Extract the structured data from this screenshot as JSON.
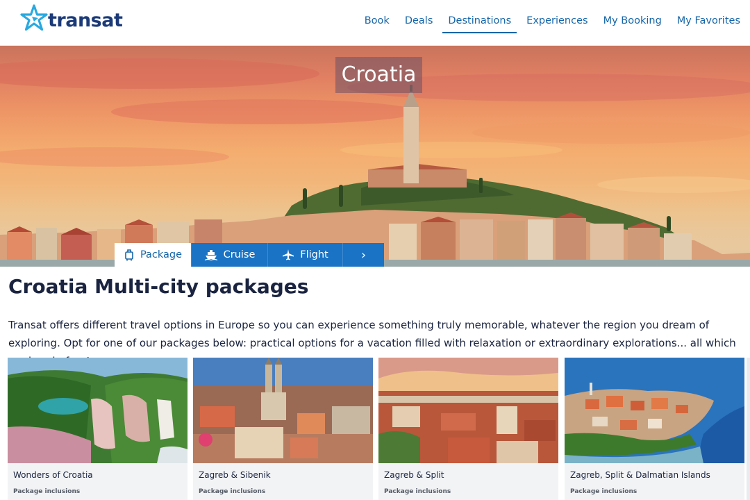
{
  "brand": {
    "name": "transat",
    "logo_icon": "star-icon",
    "colors": {
      "primary": "#1565a8",
      "navy": "#1b3a78",
      "accent_star": "#29a9e0"
    }
  },
  "nav": {
    "items": [
      {
        "label": "Book"
      },
      {
        "label": "Deals"
      },
      {
        "label": "Destinations",
        "active": true
      },
      {
        "label": "Experiences"
      },
      {
        "label": "My Booking"
      },
      {
        "label": "My Favorites"
      }
    ]
  },
  "hero": {
    "title": "Croatia"
  },
  "tabs": {
    "package": {
      "label": "Package",
      "icon": "luggage-icon"
    },
    "cruise": {
      "label": "Cruise",
      "icon": "ship-icon"
    },
    "flight": {
      "label": "Flight",
      "icon": "plane-icon"
    },
    "more": {
      "label": "›",
      "icon": "chevron-right-icon"
    }
  },
  "main": {
    "title": "Croatia Multi-city packages",
    "intro": "Transat offers different travel options in Europe so you can experience something truly memorable, whatever the region you dream of exploring. Opt for one of our packages below: practical options for a vacation filled with relaxation or extraordinary explorations... all which are hassle-free!"
  },
  "cards": [
    {
      "name": "Wonders of Croatia",
      "inclusions": "Package inclusions"
    },
    {
      "name": "Zagreb & Sibenik",
      "inclusions": "Package inclusions"
    },
    {
      "name": "Zagreb & Split",
      "inclusions": "Package inclusions"
    },
    {
      "name": "Zagreb, Split & Dalmatian Islands",
      "inclusions": "Package inclusions"
    }
  ]
}
